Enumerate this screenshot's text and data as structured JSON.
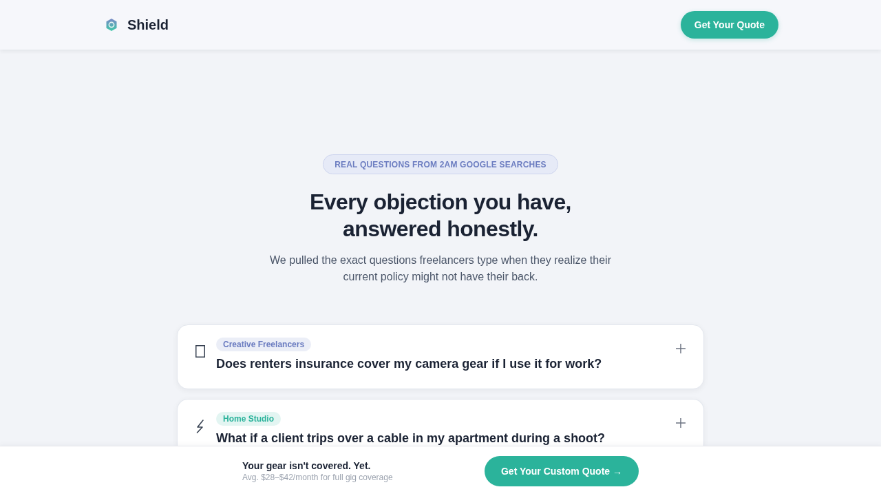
{
  "header": {
    "logo": "Shield",
    "button": "Get Your Quote"
  },
  "hero": {
    "eyebrow": "REAL QUESTIONS FROM 2AM GOOGLE SEARCHES",
    "title_lines": [
      "Every objection you have,",
      "answered honestly."
    ],
    "subtitle": "We pulled the exact questions freelancers type when they realize their current policy might not have their back."
  },
  "faq": [
    {
      "tag": "Creative Freelancers",
      "color": "#6b7cc0",
      "question": "Does renters insurance cover my camera gear if I use it for work?",
      "expanded": false
    },
    {
      "tag": "Home Studio",
      "color": "#2bb39b",
      "question": "What if a client trips over a cable in my apartment during a shoot?",
      "expanded": false
    }
  ],
  "sticky_bar": {
    "title": "Your gear isn't covered. Yet.",
    "note": "Avg. $28–$42/month for full gig coverage",
    "button": "Get Your Custom Quote →"
  }
}
